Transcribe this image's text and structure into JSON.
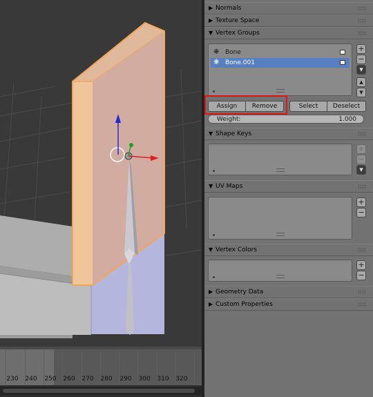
{
  "timeline": {
    "frames": [
      "230",
      "240",
      "250",
      "260",
      "270",
      "280",
      "290",
      "300",
      "310",
      "320"
    ]
  },
  "panels": {
    "normals": {
      "title": "Normals",
      "expanded": false
    },
    "texture_space": {
      "title": "Texture Space",
      "expanded": false
    },
    "vertex_groups": {
      "title": "Vertex Groups",
      "expanded": true,
      "items": [
        {
          "label": "Bone",
          "selected": false,
          "icon": "vertex-group-icon"
        },
        {
          "label": "Bone.001",
          "selected": true,
          "icon": "vertex-group-icon"
        }
      ],
      "assign": "Assign",
      "remove": "Remove",
      "select": "Select",
      "deselect": "Deselect",
      "weight_label": "Weight:",
      "weight_value": "1.000"
    },
    "shape_keys": {
      "title": "Shape Keys",
      "expanded": true
    },
    "uv_maps": {
      "title": "UV Maps",
      "expanded": true
    },
    "vertex_colors": {
      "title": "Vertex Colors",
      "expanded": true
    },
    "geometry_data": {
      "title": "Geometry Data",
      "expanded": false
    },
    "custom_properties": {
      "title": "Custom Properties",
      "expanded": false
    }
  },
  "glyphs": {
    "expanded": "▼",
    "collapsed": "▶",
    "plus": "+",
    "minus": "−",
    "down": "▾",
    "up": "▴",
    "vgroup": "❋"
  },
  "colors": {
    "selection": "#5680c2",
    "highlight_box": "#e0141a",
    "selected_face": "#d4a898",
    "selected_edge": "#f2a65a"
  }
}
